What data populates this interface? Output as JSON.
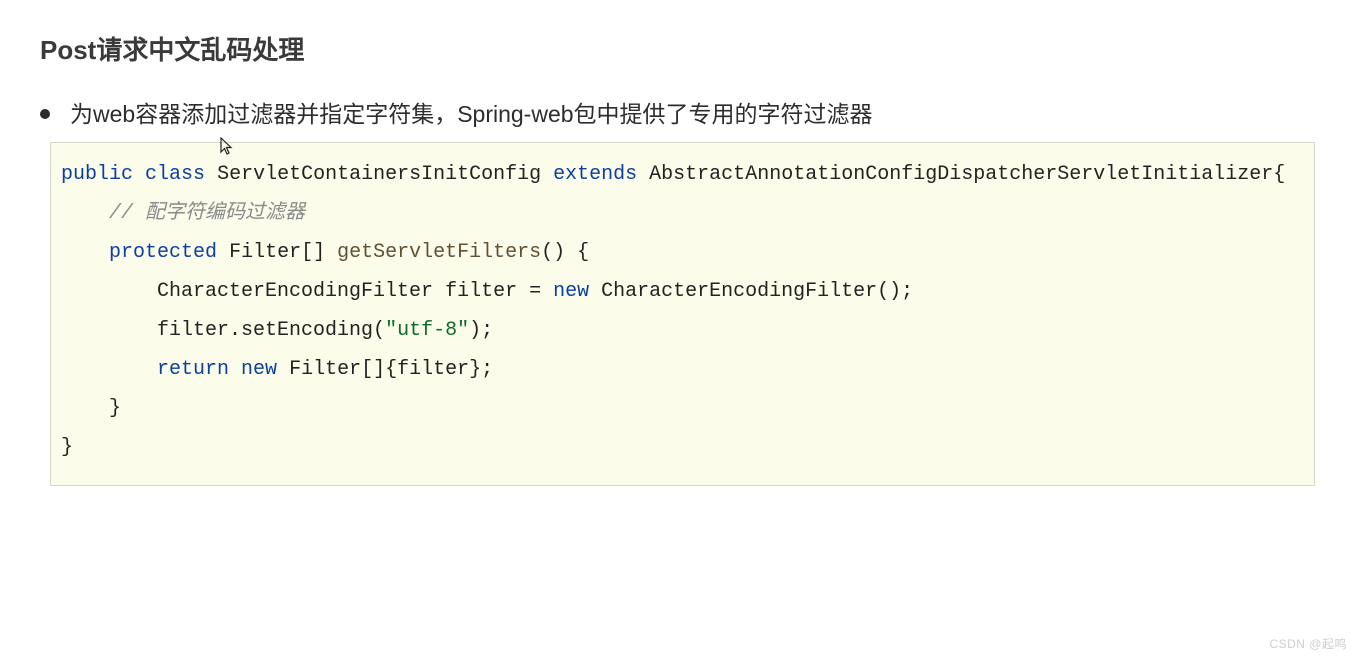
{
  "title": "Post请求中文乱码处理",
  "bullet": "为web容器添加过滤器并指定字符集，Spring-web包中提供了专用的字符过滤器",
  "cursor_glyph": "↖",
  "code": {
    "line1": {
      "kw_public": "public",
      "kw_class": "class",
      "class_name": "ServletContainersInitConfig",
      "kw_extends": "extends",
      "super_name": "AbstractAnnotationConfigDispatcherServletInitializer{"
    },
    "line2_comment": "// 配字符编码过滤器",
    "line3": {
      "kw_protected": "protected",
      "ret_type": "Filter[]",
      "method": "getServletFilters",
      "tail": "() {"
    },
    "line4": {
      "lead": "        CharacterEncodingFilter filter = ",
      "kw_new": "new",
      "tail": " CharacterEncodingFilter();"
    },
    "line5": {
      "lead": "        filter.setEncoding(",
      "str": "\"utf-8\"",
      "tail": ");"
    },
    "line6": {
      "lead": "        ",
      "kw_return": "return",
      "sp": " ",
      "kw_new": "new",
      "tail": " Filter[]{filter};"
    },
    "line7": "    }",
    "line8": "}"
  },
  "watermark": "CSDN @起鸣"
}
